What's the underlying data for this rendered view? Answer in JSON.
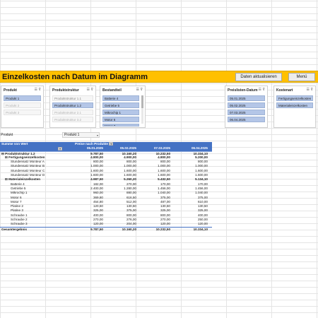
{
  "header": {
    "title": "Einzelkosten nach Datum im Diagramm",
    "update_button": "Daten aktualisieren",
    "menu_button": "Menü"
  },
  "slicers": {
    "produkt": {
      "title": "Produkt",
      "items": [
        "Produkt 1",
        "Produkt 2",
        "Produkt 3"
      ]
    },
    "produktstruktur": {
      "title": "Produktstruktur",
      "items": [
        "Produktstruktur 1.1",
        "Produktstruktur 1.2",
        "Produktstruktur 2.1",
        "Produktstruktur 3.2"
      ]
    },
    "bestandteil": {
      "title": "Bestandteil",
      "items": [
        "Batterie 4",
        "Getriebe 5",
        "Mikrochip 1",
        "Motor 6",
        "Motor 7"
      ]
    },
    "preislisten_datum": {
      "title": "Preislisten-Datum",
      "items": [
        "05.01.2025",
        "05.02.2025",
        "07.03.2025",
        "06.04.2025"
      ]
    },
    "kostenart": {
      "title": "Kostenart",
      "items": [
        "Fertigungseinzelkosten",
        "Materialeinzelkosten"
      ]
    }
  },
  "filter": {
    "label": "Produkt",
    "value": "Produkt 1"
  },
  "pivot": {
    "value_label": "Summe von Wert",
    "column_field": "Preise nach Produkte",
    "dates": [
      "05.01.2025",
      "05.02.2025",
      "07.03.2025",
      "06.04.2025"
    ],
    "rows": [
      {
        "label": "Produktstruktur 1.2",
        "values": [
          "9.787,50",
          "10.160,20",
          "10.232,50",
          "10.334,10"
        ]
      },
      {
        "label": "Fertigungseinzelkosten",
        "values": [
          "4.800,00",
          "4.900,00",
          "4.800,00",
          "5.200,00"
        ]
      },
      {
        "label": "Stundensatz Monteur A",
        "values": [
          "800,00",
          "800,00",
          "800,00",
          "800,00"
        ]
      },
      {
        "label": "Stundensatz Monteur B",
        "values": [
          "1.000,00",
          "1.000,00",
          "1.000,00",
          "1.000,00"
        ]
      },
      {
        "label": "Stundensatz Monteur C",
        "values": [
          "1.600,00",
          "1.600,00",
          "1.600,00",
          "1.600,00"
        ]
      },
      {
        "label": "Stundensatz Monteur D",
        "values": [
          "1.600,00",
          "1.600,00",
          "1.600,00",
          "1.600,00"
        ]
      },
      {
        "label": "Materialeinzelkosten",
        "values": [
          "4.987,50",
          "5.260,20",
          "5.432,50",
          "5.134,10"
        ]
      },
      {
        "label": "Batterie 4",
        "values": [
          "182,00",
          "270,00",
          "170,00",
          "170,00"
        ]
      },
      {
        "label": "Getriebe 5",
        "values": [
          "2.400,00",
          "1.280,00",
          "1.456,00",
          "1.456,00"
        ]
      },
      {
        "label": "Mikrochip 1",
        "values": [
          "960,00",
          "880,00",
          "1.040,00",
          "1.040,00"
        ]
      },
      {
        "label": "Motor 6",
        "values": [
          "369,80",
          "616,50",
          "375,00",
          "375,00"
        ]
      },
      {
        "label": "Motor 7",
        "values": [
          "454,80",
          "512,00",
          "487,00",
          "610,00"
        ]
      },
      {
        "label": "Platine 2",
        "values": [
          "120,50",
          "130,50",
          "130,50",
          "130,50"
        ]
      },
      {
        "label": "Platine 3",
        "values": [
          "325,00",
          "375,00",
          "325,00",
          "325,00"
        ]
      },
      {
        "label": "Schraube 1",
        "values": [
          "400,00",
          "800,00",
          "800,00",
          "400,00"
        ]
      },
      {
        "label": "Schraube 2",
        "values": [
          "270,00",
          "276,00",
          "270,00",
          "250,00"
        ]
      },
      {
        "label": "Schraube 3",
        "values": [
          "120,00",
          "204,00",
          "120,00",
          "120,00"
        ]
      }
    ],
    "total": {
      "label": "Gesamtergebnis",
      "values": [
        "9.787,50",
        "10.160,20",
        "10.232,50",
        "10.334,10"
      ]
    }
  }
}
